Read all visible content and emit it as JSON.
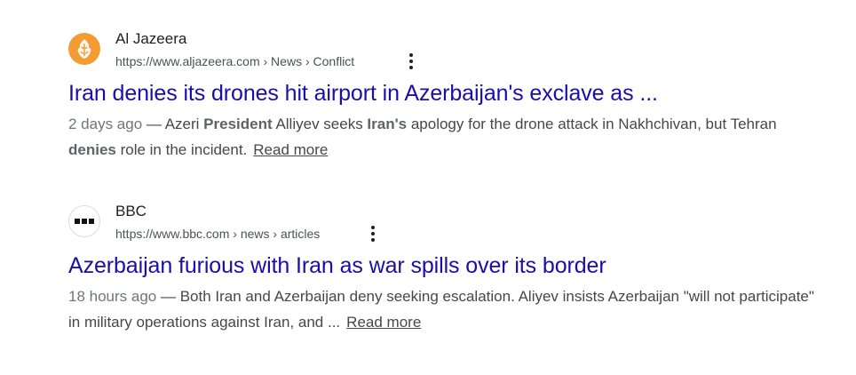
{
  "results": [
    {
      "site_name": "Al Jazeera",
      "url": "https://www.aljazeera.com › News › Conflict",
      "favicon_icon": "aljazeera-logo-icon",
      "favicon_color": "#f39c33",
      "title": "Iran denies its drones hit airport in Azerbaijan's exclave as ...",
      "snippet": {
        "date": "2 days ago",
        "sep": " — ",
        "t1": "Azeri ",
        "b1": "President",
        "t2": " Alliyev seeks ",
        "b2": "Iran's",
        "t3": " apology for the drone attack in Nakhchivan, but Tehran ",
        "b3": "denies",
        "t4": " role in the incident.",
        "read_more": "Read more"
      }
    },
    {
      "site_name": "BBC",
      "url": "https://www.bbc.com › news › articles",
      "favicon_icon": "bbc-logo-icon",
      "title": "Azerbaijan furious with Iran as war spills over its border",
      "snippet": {
        "date": "18 hours ago",
        "sep": " — ",
        "t1": "Both Iran and Azerbaijan deny seeking escalation. Aliyev insists Azerbaijan \"will not participate\" in military operations against Iran, and ...",
        "read_more": "Read more"
      }
    }
  ],
  "colors": {
    "title_link": "#1a0dab",
    "snippet_text": "#474747",
    "date_text": "#70757a"
  },
  "icons": {
    "more_options": "three-dots-vertical-icon"
  }
}
